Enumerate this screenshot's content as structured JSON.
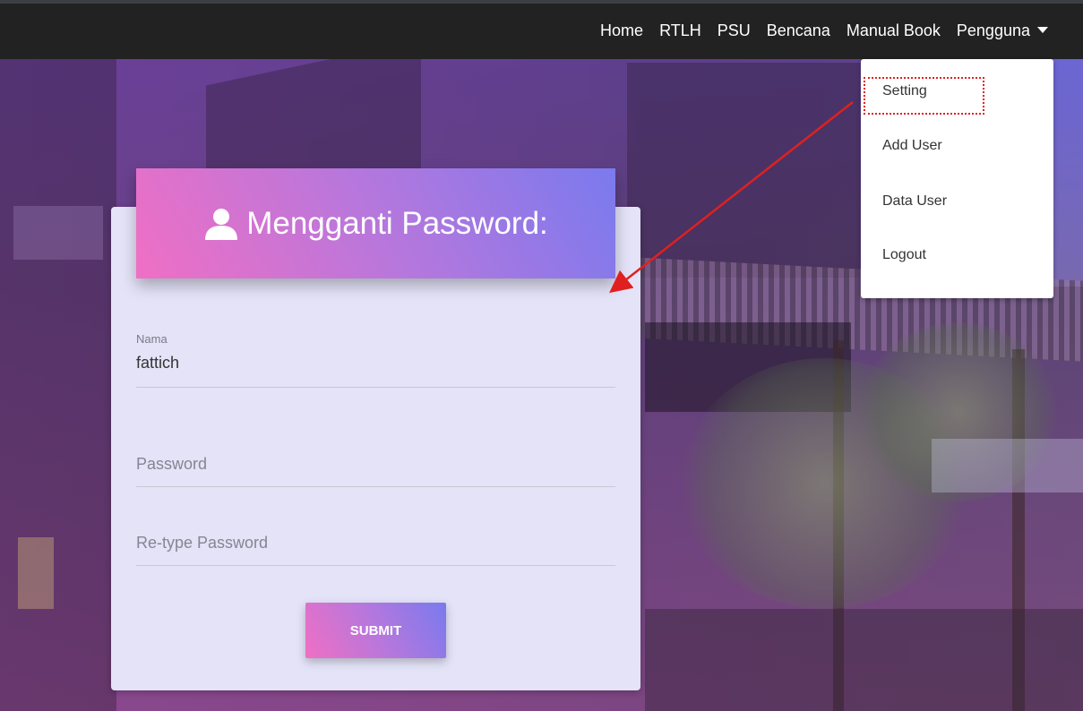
{
  "nav": {
    "items": [
      "Home",
      "RTLH",
      "PSU",
      "Bencana",
      "Manual Book"
    ],
    "dropdown_label": "Pengguna"
  },
  "dropdown": {
    "items": [
      "Setting",
      "Add User",
      "Data User",
      "Logout"
    ]
  },
  "form": {
    "title": "Mengganti Password:",
    "nama_label": "Nama",
    "nama_value": "fattich",
    "password_placeholder": "Password",
    "retype_placeholder": "Re-type Password",
    "submit_label": "SUBMIT"
  },
  "colors": {
    "navbar": "#222222",
    "gradient_start": "#f06fc4",
    "gradient_end": "#7a7aee",
    "annotation": "#e02020"
  },
  "icons": {
    "header_icon": "user-icon",
    "dropdown_caret": "caret-down-icon"
  }
}
